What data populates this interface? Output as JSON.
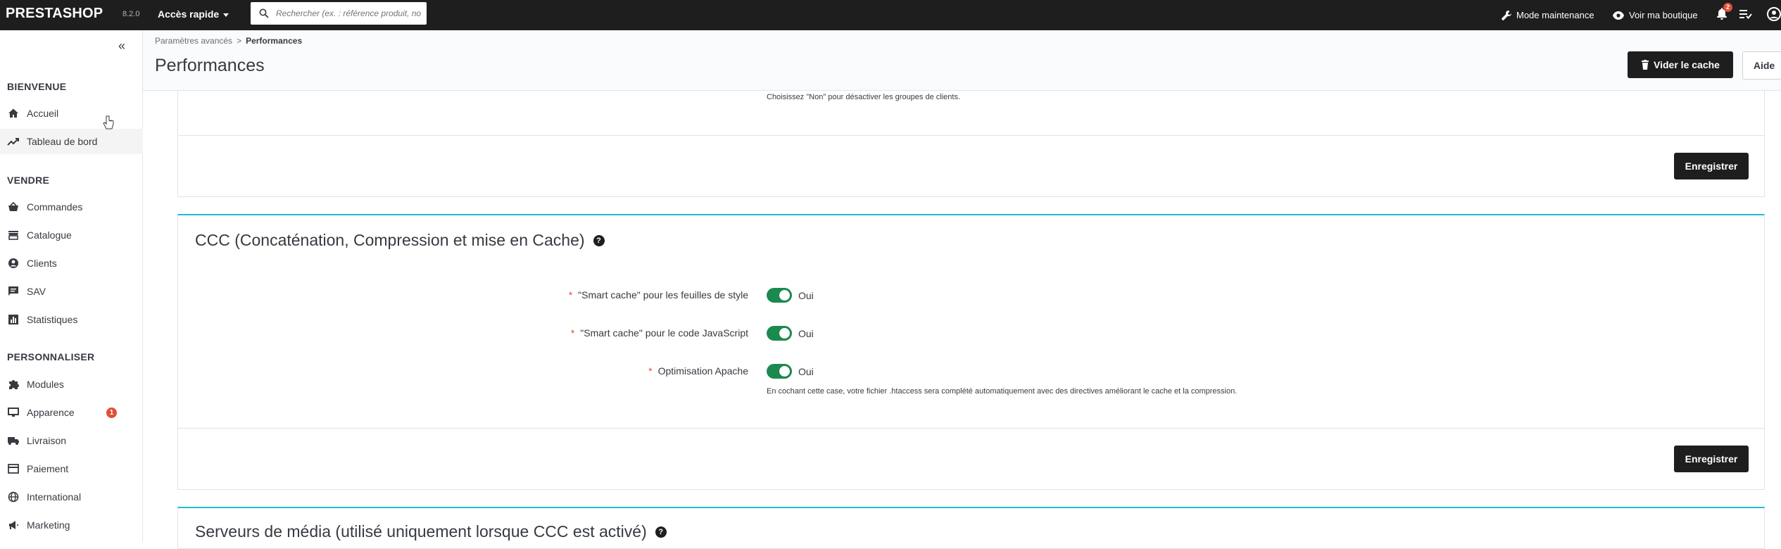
{
  "topbar": {
    "logo": "PRESTASHOP",
    "version": "8.2.0",
    "quick_access": "Accès rapide",
    "search_placeholder": "Rechercher (ex. : référence produit, no",
    "maintenance": "Mode maintenance",
    "view_shop": "Voir ma boutique",
    "notif_count": "2"
  },
  "sidebar": {
    "collapse_glyph": "«",
    "sections": [
      {
        "title": "BIENVENUE",
        "items": [
          {
            "label": "Accueil",
            "icon": "home-icon"
          },
          {
            "label": "Tableau de bord",
            "icon": "trending-up-icon"
          }
        ]
      },
      {
        "title": "VENDRE",
        "items": [
          {
            "label": "Commandes",
            "icon": "basket-icon"
          },
          {
            "label": "Catalogue",
            "icon": "store-icon"
          },
          {
            "label": "Clients",
            "icon": "account-circle-icon"
          },
          {
            "label": "SAV",
            "icon": "chat-icon"
          },
          {
            "label": "Statistiques",
            "icon": "bar-chart-icon"
          }
        ]
      },
      {
        "title": "PERSONNALISER",
        "items": [
          {
            "label": "Modules",
            "icon": "puzzle-icon"
          },
          {
            "label": "Apparence",
            "icon": "desktop-icon",
            "badge": "1"
          },
          {
            "label": "Livraison",
            "icon": "truck-icon"
          },
          {
            "label": "Paiement",
            "icon": "credit-card-icon"
          },
          {
            "label": "International",
            "icon": "globe-icon"
          },
          {
            "label": "Marketing",
            "icon": "campaign-icon"
          }
        ]
      }
    ]
  },
  "header": {
    "breadcrumb_parent": "Paramètres avancés",
    "breadcrumb_sep": ">",
    "breadcrumb_current": "Performances",
    "title": "Performances",
    "clear_cache": "Vider le cache",
    "help": "Aide"
  },
  "content": {
    "customer_groups_hint": "Choisissez \"Non\" pour désactiver les groupes de clients.",
    "save_label": "Enregistrer",
    "ccc": {
      "title": "CCC (Concaténation, Compression et mise en Cache)",
      "rows": [
        {
          "label": "\"Smart cache\" pour les feuilles de style",
          "value": "Oui"
        },
        {
          "label": "\"Smart cache\" pour le code JavaScript",
          "value": "Oui"
        },
        {
          "label": "Optimisation Apache",
          "value": "Oui"
        }
      ],
      "apache_hint": "En cochant cette case, votre fichier .htaccess sera complété automatiquement avec des directives améliorant le cache et la compression."
    },
    "media_title": "Serveurs de média (utilisé uniquement lorsque CCC est activé)",
    "required_mark": "*",
    "help_glyph": "?"
  },
  "colors": {
    "topbar": "#1e1e1e",
    "accent": "#25b9d7",
    "toggle_on": "#1b8a4f",
    "required": "#e04f38"
  }
}
